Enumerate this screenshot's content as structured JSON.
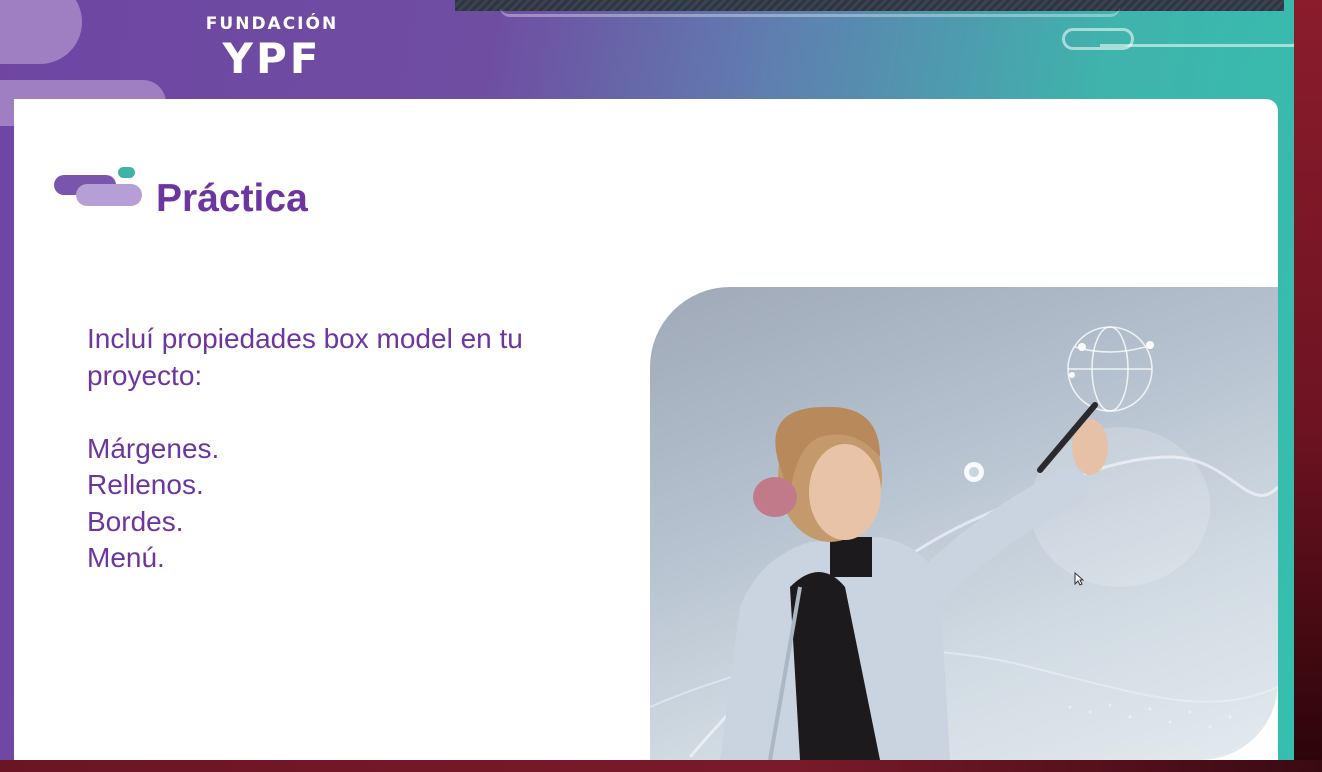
{
  "brand": {
    "logo_top": "FUNDACIÓN",
    "logo_main": "YPF"
  },
  "slide": {
    "title": "Práctica",
    "intro": "Incluí propiedades box model en tu proyecto:",
    "items": [
      "Márgenes.",
      "Rellenos.",
      "Bordes.",
      "Menú."
    ]
  },
  "colors": {
    "accent_purple": "#6c35a0",
    "teal": "#35bfae",
    "lavender": "#b59fd6"
  },
  "icons": {
    "title_decoration": "pill-shapes-icon",
    "cursor": "mouse-pointer-icon"
  }
}
